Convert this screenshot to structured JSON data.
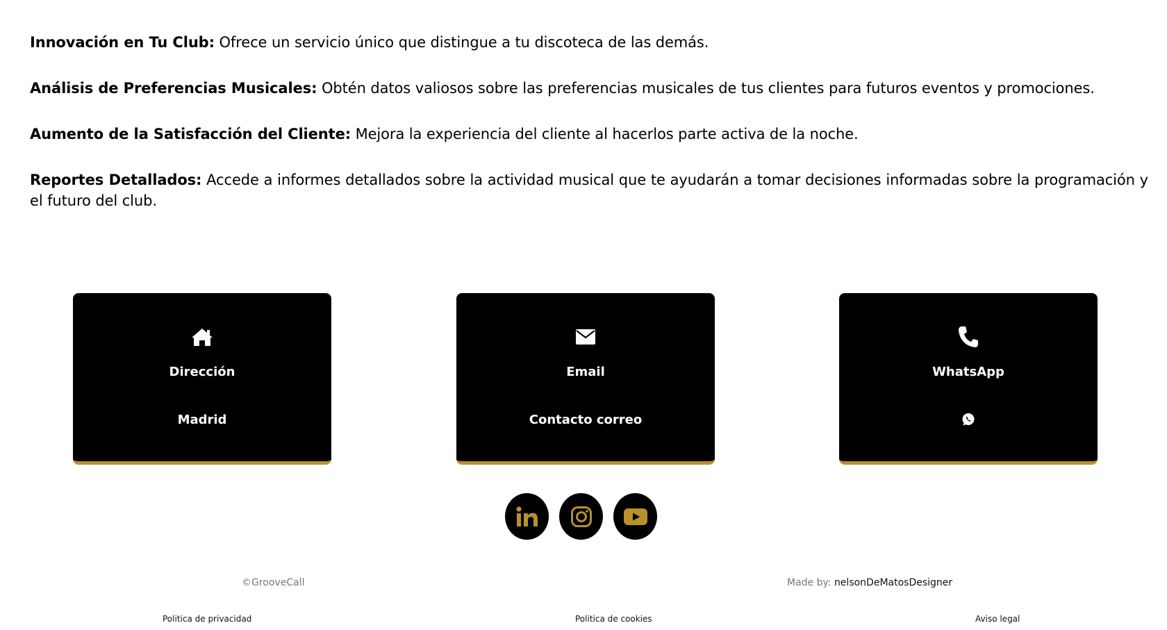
{
  "features": [
    {
      "title": "Innovación en Tu Club:",
      "text": " Ofrece un servicio único que distingue a tu discoteca de las demás."
    },
    {
      "title": "Análisis de Preferencias Musicales:",
      "text": " Obtén datos valiosos sobre las preferencias musicales de tus clientes para futuros eventos y promociones."
    },
    {
      "title": "Aumento de la Satisfacción del Cliente:",
      "text": " Mejora la experiencia del cliente al hacerlos parte activa de la noche."
    },
    {
      "title": "Reportes Detallados:",
      "text": " Accede a informes detallados sobre la actividad musical que te ayudarán a tomar decisiones informadas sobre la programación y el futuro del club."
    }
  ],
  "cards": {
    "address": {
      "icon": "home-icon",
      "title": "Dirección",
      "value": "Madrid"
    },
    "email": {
      "icon": "envelope-icon",
      "title": "Email",
      "value": "Contacto correo"
    },
    "whatsapp": {
      "icon": "phone-icon",
      "title": "WhatsApp",
      "value_icon": "whatsapp-icon"
    }
  },
  "socials": [
    {
      "name": "linkedin-icon"
    },
    {
      "name": "instagram-icon"
    },
    {
      "name": "youtube-icon"
    }
  ],
  "footer": {
    "copyright": "©GrooveCall",
    "made_by_label": "Made by: ",
    "made_by_name": "nelsonDeMatosDesigner",
    "privacy": "Politica de privacidad",
    "cookies": "Politica de cookies",
    "legal": "Aviso legal"
  },
  "colors": {
    "accent": "#b8912a",
    "card_bg": "#000000"
  }
}
